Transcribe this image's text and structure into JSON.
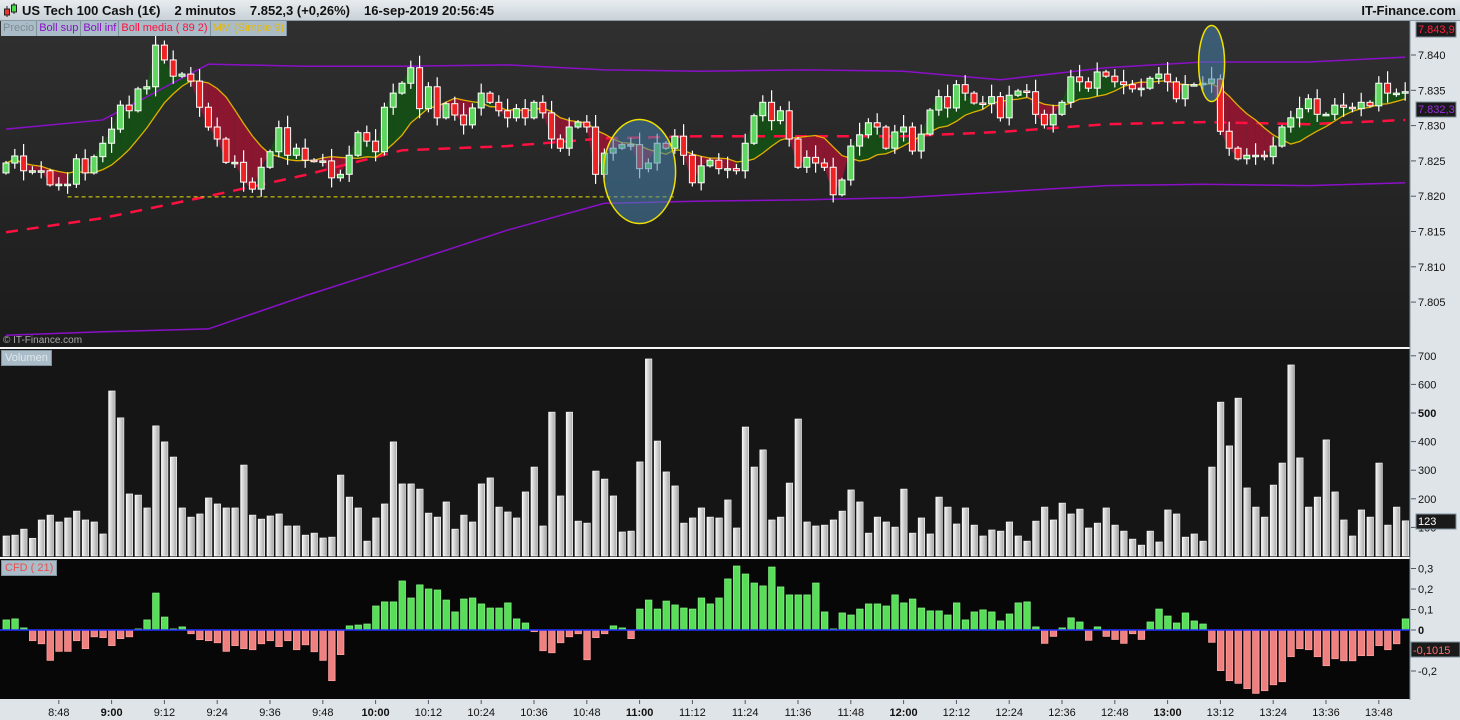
{
  "header": {
    "instrument": "US Tech 100 Cash (1€)",
    "timeframe": "2 minutos",
    "last_price": "7.852,3 (+0,26%)",
    "datetime": "16-sep-2019 20:56:45",
    "brand": "IT-Finance.com"
  },
  "legend": {
    "precio": "Precio",
    "boll_sup": "Boll sup",
    "boll_inf": "Boll inf",
    "boll_media": "Boll media ( 89 2)",
    "mm": "MM (Simple 9)"
  },
  "copyright": "© IT-Finance.com",
  "colors": {
    "up": "#5fd65f",
    "down": "#ee2222",
    "boll": "#8a10c8",
    "media": "#ff1040",
    "mm": "#e0b000",
    "fill_up": "#164d16",
    "fill_down": "#8a1630"
  },
  "chart_data": [
    {
      "type": "candlestick",
      "title": "US Tech 100 Cash (1€) 2 minutos",
      "ylim": [
        7798,
        7846
      ],
      "yticks": [
        "7.840",
        "7.835",
        "7.830",
        "7.825",
        "7.820",
        "7.815",
        "7.810",
        "7.805"
      ],
      "ytick_values": [
        7840,
        7835,
        7830,
        7825,
        7820,
        7815,
        7810,
        7805
      ],
      "value_labels": {
        "high": "7.843,9",
        "boll": "7.832,3"
      },
      "first_open": 7823.3,
      "close": [
        7824.7,
        7825.7,
        7823.6,
        7823.6,
        7823.6,
        7821.6,
        7821.7,
        7821.7,
        7825.3,
        7823.3,
        7825.6,
        7827.5,
        7829.5,
        7832.9,
        7832.1,
        7835.2,
        7835.5,
        7841.4,
        7839.3,
        7837.0,
        7837.3,
        7836.3,
        7832.6,
        7829.8,
        7828.1,
        7824.8,
        7824.8,
        7822.0,
        7821.0,
        7824.1,
        7826.3,
        7829.7,
        7825.8,
        7826.8,
        7825.1,
        7825.0,
        7825.0,
        7822.6,
        7823.1,
        7825.8,
        7829.0,
        7827.8,
        7826.3,
        7832.6,
        7834.6,
        7836.0,
        7838.2,
        7832.4,
        7835.5,
        7831.1,
        7833.1,
        7831.5,
        7830.1,
        7832.5,
        7834.6,
        7833.3,
        7832.1,
        7831.1,
        7832.4,
        7831.1,
        7833.3,
        7831.8,
        7828.1,
        7826.8,
        7829.8,
        7830.5,
        7829.8,
        7823.1,
        7826.1,
        7826.8,
        7827.3,
        7827.3,
        7823.9,
        7824.7,
        7827.5,
        7826.8,
        7828.5,
        7825.8,
        7821.9,
        7824.3,
        7825.1,
        7823.9,
        7823.9,
        7823.6,
        7827.5,
        7831.4,
        7833.3,
        7830.7,
        7832.1,
        7828.1,
        7824.1,
        7825.5,
        7824.7,
        7824.1,
        7820.2,
        7822.3,
        7827.1,
        7828.7,
        7830.4,
        7829.8,
        7826.8,
        7829.1,
        7829.8,
        7826.4,
        7828.8,
        7832.2,
        7834.1,
        7832.5,
        7835.8,
        7834.6,
        7833.2,
        7833.1,
        7834.1,
        7831.1,
        7834.3,
        7834.9,
        7834.8,
        7831.6,
        7830.1,
        7831.6,
        7833.3,
        7836.9,
        7836.2,
        7835.3,
        7837.6,
        7837.0,
        7836.2,
        7835.8,
        7835.2,
        7835.3,
        7836.7,
        7837.3,
        7836.2,
        7833.8,
        7835.8,
        7835.8,
        7836.0,
        7836.6,
        7829.2,
        7826.8,
        7825.3,
        7825.8,
        7825.8,
        7825.6,
        7827.1,
        7829.8,
        7831.1,
        7832.4,
        7833.8,
        7831.6,
        7831.6,
        7832.9,
        7832.6,
        7832.4,
        7833.3,
        7832.8,
        7836.0,
        7834.6,
        7834.6,
        7834.8
      ],
      "bollinger_sample_index": [
        0,
        11,
        23,
        34,
        45,
        57,
        68,
        79,
        91,
        102,
        113,
        125,
        136,
        148,
        159
      ],
      "boll_sup": [
        7829.5,
        7830.8,
        7838.7,
        7838.4,
        7838.4,
        7838.6,
        7837.9,
        7837.7,
        7837.9,
        7837.7,
        7836.5,
        7838.2,
        7839.0,
        7839.0,
        7839.7
      ],
      "boll_inf": [
        7800.3,
        7800.8,
        7801.2,
        7805.9,
        7810.3,
        7815.2,
        7819.0,
        7819.3,
        7819.5,
        7819.8,
        7820.6,
        7821.5,
        7821.7,
        7821.5,
        7821.9
      ],
      "boll_media": [
        7814.9,
        7816.9,
        7820.0,
        7823.0,
        7826.5,
        7827.1,
        7828.2,
        7828.5,
        7828.5,
        7828.5,
        7829.1,
        7830.2,
        7830.5,
        7830.2,
        7830.8
      ],
      "support_line": {
        "value": 7819.9,
        "from_index": 7,
        "to_index": 76
      },
      "annotations": [
        {
          "type": "ellipse",
          "center_index": 72,
          "center_value": 7823.5
        },
        {
          "type": "ellipse",
          "center_index": 137,
          "center_value": 7838.8
        }
      ]
    },
    {
      "type": "bar",
      "title": "Volumen",
      "ylim": [
        0,
        720
      ],
      "yticks": [
        "700",
        "600",
        "500",
        "400",
        "300",
        "200",
        "100"
      ],
      "ytick_values": [
        700,
        600,
        500,
        400,
        300,
        200,
        100
      ],
      "value_label": "123",
      "values": [
        70,
        73,
        94,
        62,
        126,
        143,
        119,
        133,
        157,
        126,
        119,
        77,
        577,
        483,
        217,
        213,
        168,
        455,
        399,
        346,
        168,
        136,
        147,
        203,
        182,
        168,
        168,
        318,
        143,
        129,
        140,
        147,
        105,
        105,
        73,
        80,
        63,
        66,
        283,
        206,
        168,
        52,
        133,
        182,
        399,
        252,
        252,
        234,
        150,
        136,
        189,
        94,
        143,
        119,
        252,
        273,
        171,
        154,
        133,
        224,
        311,
        105,
        503,
        210,
        503,
        122,
        115,
        297,
        269,
        210,
        84,
        87,
        329,
        689,
        402,
        294,
        245,
        115,
        133,
        168,
        136,
        133,
        196,
        98,
        451,
        311,
        371,
        126,
        136,
        255,
        479,
        119,
        105,
        108,
        126,
        157,
        231,
        189,
        80,
        136,
        119,
        101,
        234,
        80,
        133,
        77,
        206,
        171,
        112,
        168,
        108,
        70,
        91,
        87,
        119,
        70,
        52,
        122,
        171,
        126,
        185,
        147,
        164,
        98,
        115,
        168,
        108,
        87,
        59,
        38,
        87,
        49,
        161,
        147,
        66,
        77,
        52,
        311,
        538,
        385,
        552,
        238,
        171,
        136,
        248,
        325,
        668,
        343,
        171,
        206,
        406,
        224,
        126,
        70,
        161,
        136,
        325,
        108,
        171,
        123
      ]
    },
    {
      "type": "bar",
      "title": "CFD ( 21)",
      "ylim": [
        -0.34,
        0.33
      ],
      "yticks": [
        "0,3",
        "0,2",
        "0,1",
        "0",
        "-0,2"
      ],
      "ytick_values": [
        0.3,
        0.2,
        0.1,
        0,
        -0.2
      ],
      "value_label": "-0,1015",
      "values": [
        0.049,
        0.054,
        0.01,
        -0.052,
        -0.067,
        -0.148,
        -0.104,
        -0.104,
        -0.052,
        -0.091,
        -0.033,
        -0.037,
        -0.076,
        -0.042,
        -0.033,
        0.005,
        0.049,
        0.18,
        0.063,
        0.005,
        0.015,
        -0.018,
        -0.047,
        -0.052,
        -0.062,
        -0.104,
        -0.076,
        -0.091,
        -0.096,
        -0.067,
        -0.052,
        -0.081,
        -0.052,
        -0.096,
        -0.072,
        -0.106,
        -0.148,
        -0.247,
        -0.12,
        0.02,
        0.024,
        0.029,
        0.117,
        0.137,
        0.137,
        0.239,
        0.156,
        0.22,
        0.2,
        0.195,
        0.146,
        0.088,
        0.151,
        0.156,
        0.127,
        0.107,
        0.107,
        0.132,
        0.054,
        0.034,
        -0.008,
        -0.101,
        -0.111,
        -0.062,
        -0.033,
        -0.018,
        -0.145,
        -0.037,
        -0.018,
        0.02,
        0.01,
        -0.042,
        0.102,
        0.146,
        0.102,
        0.141,
        0.122,
        0.107,
        0.102,
        0.156,
        0.127,
        0.156,
        0.249,
        0.312,
        0.273,
        0.229,
        0.215,
        0.307,
        0.21,
        0.171,
        0.171,
        0.171,
        0.229,
        0.088,
        0.005,
        0.083,
        0.073,
        0.102,
        0.127,
        0.127,
        0.117,
        0.171,
        0.132,
        0.151,
        0.107,
        0.093,
        0.093,
        0.073,
        0.132,
        0.049,
        0.088,
        0.098,
        0.088,
        0.044,
        0.078,
        0.132,
        0.137,
        0.015,
        -0.065,
        -0.031,
        0.01,
        0.059,
        0.039,
        -0.05,
        0.015,
        -0.031,
        -0.046,
        -0.065,
        -0.018,
        -0.046,
        0.039,
        0.102,
        0.068,
        0.034,
        0.083,
        0.044,
        0.029,
        -0.06,
        -0.198,
        -0.247,
        -0.26,
        -0.286,
        -0.309,
        -0.296,
        -0.267,
        -0.252,
        -0.13,
        -0.091,
        -0.096,
        -0.13,
        -0.174,
        -0.14,
        -0.15,
        -0.15,
        -0.125,
        -0.125,
        -0.076,
        -0.096,
        -0.067,
        0.054
      ]
    }
  ],
  "xaxis": {
    "labels": [
      "8:48",
      "9:00",
      "9:12",
      "9:24",
      "9:36",
      "9:48",
      "10:00",
      "10:12",
      "10:24",
      "10:36",
      "10:48",
      "11:00",
      "11:12",
      "11:24",
      "11:36",
      "11:48",
      "12:00",
      "12:12",
      "12:24",
      "12:36",
      "12:48",
      "13:00",
      "13:12",
      "13:24",
      "13:36",
      "13:48"
    ],
    "bold": [
      false,
      true,
      false,
      false,
      false,
      false,
      true,
      false,
      false,
      false,
      false,
      true,
      false,
      false,
      false,
      false,
      true,
      false,
      false,
      false,
      false,
      true,
      false,
      false,
      false,
      false
    ],
    "first_label_index": 6,
    "bars_per_label": 6
  }
}
